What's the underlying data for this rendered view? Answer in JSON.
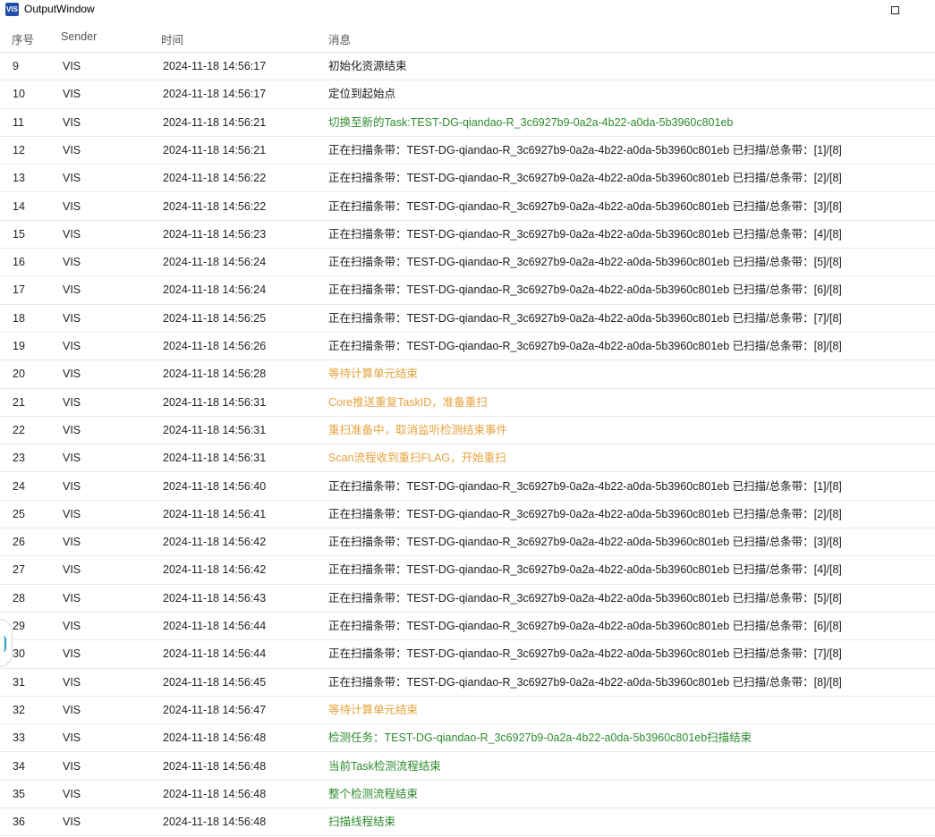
{
  "window": {
    "title": "OutputWindow",
    "icon_text": "VIS"
  },
  "columns": {
    "index": "序号",
    "sender": "Sender",
    "time": "时间",
    "message": "消息"
  },
  "colors": {
    "normal": "#1a1a1a",
    "green": "#2e8b2e",
    "orange": "#e6a23c"
  },
  "rows": [
    {
      "idx": "9",
      "sender": "VIS",
      "time": "2024-11-18 14:56:17",
      "msg": "初始化资源结束",
      "level": "normal"
    },
    {
      "idx": "10",
      "sender": "VIS",
      "time": "2024-11-18 14:56:17",
      "msg": "定位到起始点",
      "level": "normal"
    },
    {
      "idx": "11",
      "sender": "VIS",
      "time": "2024-11-18 14:56:21",
      "msg": "切换至新的Task:TEST-DG-qiandao-R_3c6927b9-0a2a-4b22-a0da-5b3960c801eb",
      "level": "green"
    },
    {
      "idx": "12",
      "sender": "VIS",
      "time": "2024-11-18 14:56:21",
      "msg": "正在扫描条带：TEST-DG-qiandao-R_3c6927b9-0a2a-4b22-a0da-5b3960c801eb  已扫描/总条带：[1]/[8]",
      "level": "normal"
    },
    {
      "idx": "13",
      "sender": "VIS",
      "time": "2024-11-18 14:56:22",
      "msg": "正在扫描条带：TEST-DG-qiandao-R_3c6927b9-0a2a-4b22-a0da-5b3960c801eb  已扫描/总条带：[2]/[8]",
      "level": "normal"
    },
    {
      "idx": "14",
      "sender": "VIS",
      "time": "2024-11-18 14:56:22",
      "msg": "正在扫描条带：TEST-DG-qiandao-R_3c6927b9-0a2a-4b22-a0da-5b3960c801eb  已扫描/总条带：[3]/[8]",
      "level": "normal"
    },
    {
      "idx": "15",
      "sender": "VIS",
      "time": "2024-11-18 14:56:23",
      "msg": "正在扫描条带：TEST-DG-qiandao-R_3c6927b9-0a2a-4b22-a0da-5b3960c801eb  已扫描/总条带：[4]/[8]",
      "level": "normal"
    },
    {
      "idx": "16",
      "sender": "VIS",
      "time": "2024-11-18 14:56:24",
      "msg": "正在扫描条带：TEST-DG-qiandao-R_3c6927b9-0a2a-4b22-a0da-5b3960c801eb  已扫描/总条带：[5]/[8]",
      "level": "normal"
    },
    {
      "idx": "17",
      "sender": "VIS",
      "time": "2024-11-18 14:56:24",
      "msg": "正在扫描条带：TEST-DG-qiandao-R_3c6927b9-0a2a-4b22-a0da-5b3960c801eb  已扫描/总条带：[6]/[8]",
      "level": "normal"
    },
    {
      "idx": "18",
      "sender": "VIS",
      "time": "2024-11-18 14:56:25",
      "msg": "正在扫描条带：TEST-DG-qiandao-R_3c6927b9-0a2a-4b22-a0da-5b3960c801eb  已扫描/总条带：[7]/[8]",
      "level": "normal"
    },
    {
      "idx": "19",
      "sender": "VIS",
      "time": "2024-11-18 14:56:26",
      "msg": "正在扫描条带：TEST-DG-qiandao-R_3c6927b9-0a2a-4b22-a0da-5b3960c801eb  已扫描/总条带：[8]/[8]",
      "level": "normal"
    },
    {
      "idx": "20",
      "sender": "VIS",
      "time": "2024-11-18 14:56:28",
      "msg": "等待计算单元结束",
      "level": "orange"
    },
    {
      "idx": "21",
      "sender": "VIS",
      "time": "2024-11-18 14:56:31",
      "msg": "Core推送重复TaskID，准备重扫",
      "level": "orange"
    },
    {
      "idx": "22",
      "sender": "VIS",
      "time": "2024-11-18 14:56:31",
      "msg": "重扫准备中，取消监听检测结束事件",
      "level": "orange"
    },
    {
      "idx": "23",
      "sender": "VIS",
      "time": "2024-11-18 14:56:31",
      "msg": "Scan流程收到重扫FLAG，开始重扫",
      "level": "orange"
    },
    {
      "idx": "24",
      "sender": "VIS",
      "time": "2024-11-18 14:56:40",
      "msg": "正在扫描条带：TEST-DG-qiandao-R_3c6927b9-0a2a-4b22-a0da-5b3960c801eb  已扫描/总条带：[1]/[8]",
      "level": "normal"
    },
    {
      "idx": "25",
      "sender": "VIS",
      "time": "2024-11-18 14:56:41",
      "msg": "正在扫描条带：TEST-DG-qiandao-R_3c6927b9-0a2a-4b22-a0da-5b3960c801eb  已扫描/总条带：[2]/[8]",
      "level": "normal"
    },
    {
      "idx": "26",
      "sender": "VIS",
      "time": "2024-11-18 14:56:42",
      "msg": "正在扫描条带：TEST-DG-qiandao-R_3c6927b9-0a2a-4b22-a0da-5b3960c801eb  已扫描/总条带：[3]/[8]",
      "level": "normal"
    },
    {
      "idx": "27",
      "sender": "VIS",
      "time": "2024-11-18 14:56:42",
      "msg": "正在扫描条带：TEST-DG-qiandao-R_3c6927b9-0a2a-4b22-a0da-5b3960c801eb  已扫描/总条带：[4]/[8]",
      "level": "normal"
    },
    {
      "idx": "28",
      "sender": "VIS",
      "time": "2024-11-18 14:56:43",
      "msg": "正在扫描条带：TEST-DG-qiandao-R_3c6927b9-0a2a-4b22-a0da-5b3960c801eb  已扫描/总条带：[5]/[8]",
      "level": "normal"
    },
    {
      "idx": "29",
      "sender": "VIS",
      "time": "2024-11-18 14:56:44",
      "msg": "正在扫描条带：TEST-DG-qiandao-R_3c6927b9-0a2a-4b22-a0da-5b3960c801eb  已扫描/总条带：[6]/[8]",
      "level": "normal"
    },
    {
      "idx": "30",
      "sender": "VIS",
      "time": "2024-11-18 14:56:44",
      "msg": "正在扫描条带：TEST-DG-qiandao-R_3c6927b9-0a2a-4b22-a0da-5b3960c801eb  已扫描/总条带：[7]/[8]",
      "level": "normal"
    },
    {
      "idx": "31",
      "sender": "VIS",
      "time": "2024-11-18 14:56:45",
      "msg": "正在扫描条带：TEST-DG-qiandao-R_3c6927b9-0a2a-4b22-a0da-5b3960c801eb  已扫描/总条带：[8]/[8]",
      "level": "normal"
    },
    {
      "idx": "32",
      "sender": "VIS",
      "time": "2024-11-18 14:56:47",
      "msg": "等待计算单元结束",
      "level": "orange"
    },
    {
      "idx": "33",
      "sender": "VIS",
      "time": "2024-11-18 14:56:48",
      "msg": "检测任务：TEST-DG-qiandao-R_3c6927b9-0a2a-4b22-a0da-5b3960c801eb扫描结束",
      "level": "green"
    },
    {
      "idx": "34",
      "sender": "VIS",
      "time": "2024-11-18 14:56:48",
      "msg": "当前Task检测流程结束",
      "level": "green"
    },
    {
      "idx": "35",
      "sender": "VIS",
      "time": "2024-11-18 14:56:48",
      "msg": "整个检测流程结束",
      "level": "green"
    },
    {
      "idx": "36",
      "sender": "VIS",
      "time": "2024-11-18 14:56:48",
      "msg": "扫描线程结束",
      "level": "green"
    }
  ]
}
